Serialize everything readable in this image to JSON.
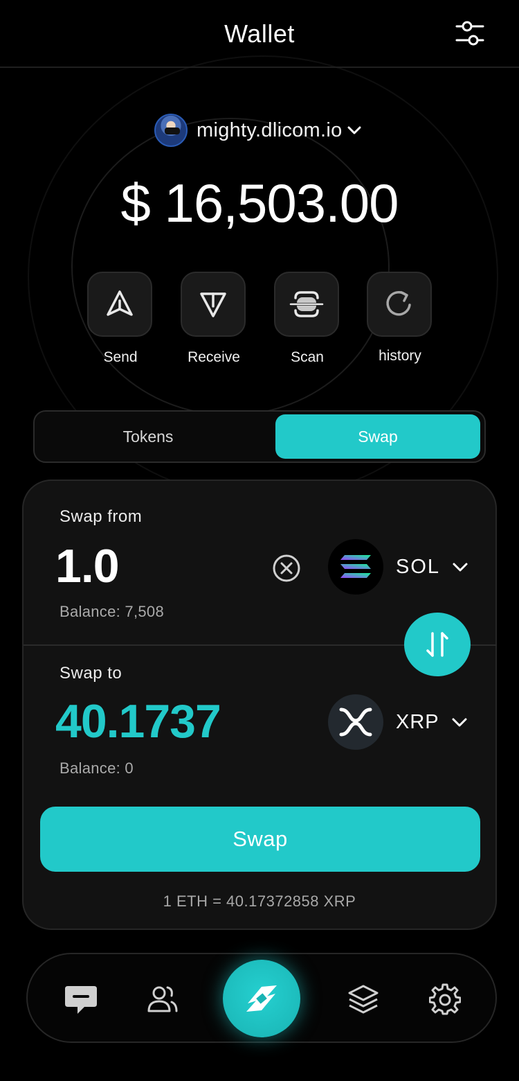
{
  "header": {
    "title": "Wallet",
    "filter_icon": "sliders-icon"
  },
  "account": {
    "name": "mighty.dlicom.io",
    "avatar_icon": "avatar",
    "chevron_icon": "chevron-down-icon"
  },
  "balance": {
    "display": "$ 16,503.00"
  },
  "actions": [
    {
      "label": "Send",
      "icon": "send-icon"
    },
    {
      "label": "Receive",
      "icon": "receive-icon"
    },
    {
      "label": "Scan",
      "icon": "scan-icon"
    },
    {
      "label": "history",
      "icon": "history-icon"
    }
  ],
  "tabs": {
    "tokens": "Tokens",
    "swap": "Swap",
    "active": "swap"
  },
  "swap": {
    "from": {
      "label": "Swap from",
      "amount": "1.0",
      "balance": "Balance: 7,508",
      "symbol": "SOL",
      "clear_icon": "clear-icon"
    },
    "to": {
      "label": "Swap to",
      "amount": "40.1737",
      "balance": "Balance: 0",
      "symbol": "XRP"
    },
    "flip_icon": "swap-arrows-icon",
    "button_label": "Swap",
    "rate": "1 ETH = 40.17372858 XRP"
  },
  "nav": [
    {
      "icon": "chat-icon"
    },
    {
      "icon": "contacts-icon"
    },
    {
      "icon": "swap-logo-icon"
    },
    {
      "icon": "layers-icon"
    },
    {
      "icon": "settings-icon"
    }
  ],
  "colors": {
    "accent": "#22c9c9",
    "background": "#000000",
    "card": "#121212",
    "sol_purple": "#9945ff",
    "sol_green": "#14f195"
  }
}
